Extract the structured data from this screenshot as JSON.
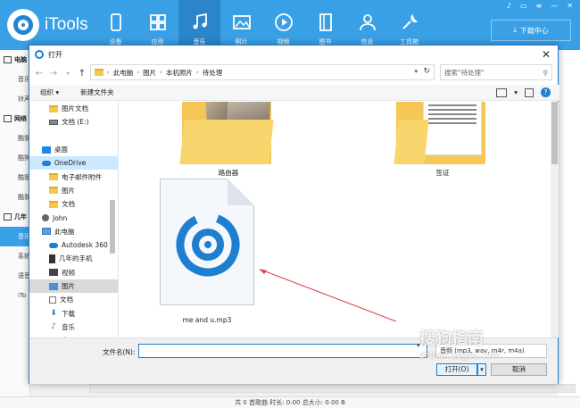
{
  "app": {
    "name": "iTools",
    "nav": [
      {
        "label": "设备",
        "icon": "phone-icon"
      },
      {
        "label": "应用",
        "icon": "apps-icon"
      },
      {
        "label": "音乐",
        "icon": "music-icon"
      },
      {
        "label": "照片",
        "icon": "photo-icon"
      },
      {
        "label": "视频",
        "icon": "video-icon"
      },
      {
        "label": "图书",
        "icon": "book-icon"
      },
      {
        "label": "信息",
        "icon": "person-icon"
      },
      {
        "label": "工具箱",
        "icon": "toolbox-icon"
      }
    ],
    "download_center": "下载中心",
    "sidebar": [
      {
        "label": "电脑",
        "head": true
      },
      {
        "label": "音乐"
      },
      {
        "label": "铃声"
      },
      {
        "label": "网络",
        "head": true
      },
      {
        "label": "酷我"
      },
      {
        "label": "酷狗"
      },
      {
        "label": "酷我"
      },
      {
        "label": "酷我"
      },
      {
        "label": "几年",
        "head": true
      },
      {
        "label": "音乐",
        "active": true
      },
      {
        "label": "系统"
      },
      {
        "label": "语音"
      },
      {
        "label": "iTo"
      }
    ],
    "status": "共 0 首歌曲  时长: 0:00  总大小: 0.00 B"
  },
  "dialog": {
    "title": "打开",
    "breadcrumb": [
      "此电脑",
      "图片",
      "本机照片",
      "待处理"
    ],
    "search_placeholder": "搜索\"待处理\"",
    "toolbar": {
      "organize": "组织 ▾",
      "new_folder": "新建文件夹"
    },
    "nav_items": [
      {
        "label": "图片文档",
        "icon": "folder",
        "indent": 1
      },
      {
        "label": "文档 (E:)",
        "icon": "drive",
        "indent": 1
      },
      {
        "label": "",
        "icon": "",
        "indent": 0
      },
      {
        "label": "桌面",
        "icon": "desktop",
        "indent": 0
      },
      {
        "label": "OneDrive",
        "icon": "cloud",
        "indent": 0,
        "sel": true
      },
      {
        "label": "电子邮件附件",
        "icon": "folder",
        "indent": 1
      },
      {
        "label": "图片",
        "icon": "folder",
        "indent": 1
      },
      {
        "label": "文档",
        "icon": "folder",
        "indent": 1
      },
      {
        "label": "John",
        "icon": "user",
        "indent": 0
      },
      {
        "label": "此电脑",
        "icon": "pc",
        "indent": 0
      },
      {
        "label": "Autodesk 360",
        "icon": "cloud",
        "indent": 1
      },
      {
        "label": "几年的手机",
        "icon": "phone",
        "indent": 1
      },
      {
        "label": "视频",
        "icon": "video",
        "indent": 1
      },
      {
        "label": "图片",
        "icon": "pic",
        "indent": 1,
        "sel2": true
      },
      {
        "label": "文档",
        "icon": "doc",
        "indent": 1
      },
      {
        "label": "下载",
        "icon": "down",
        "indent": 1
      },
      {
        "label": "音乐",
        "icon": "music",
        "indent": 1
      },
      {
        "label": "桌面",
        "icon": "desktop",
        "indent": 1
      }
    ],
    "files": [
      {
        "name": "路由器",
        "kind": "photo-folder"
      },
      {
        "name": "签证",
        "kind": "doc-folder"
      },
      {
        "name": "me and u.mp3",
        "kind": "mp3"
      }
    ],
    "filename_label": "文件名(N):",
    "filename_value": "",
    "filetype": "音频 (mp3, wav, m4r, m4a)",
    "open_button": "打开(O)",
    "cancel_button": "取消"
  },
  "watermark": {
    "text": "搜狗指南",
    "url": "zhinan.sogou.com"
  },
  "colors": {
    "header": "#3aa0e6",
    "accent": "#1e7fd0",
    "folder": "#f6c756",
    "arrow": "#d9414a"
  }
}
